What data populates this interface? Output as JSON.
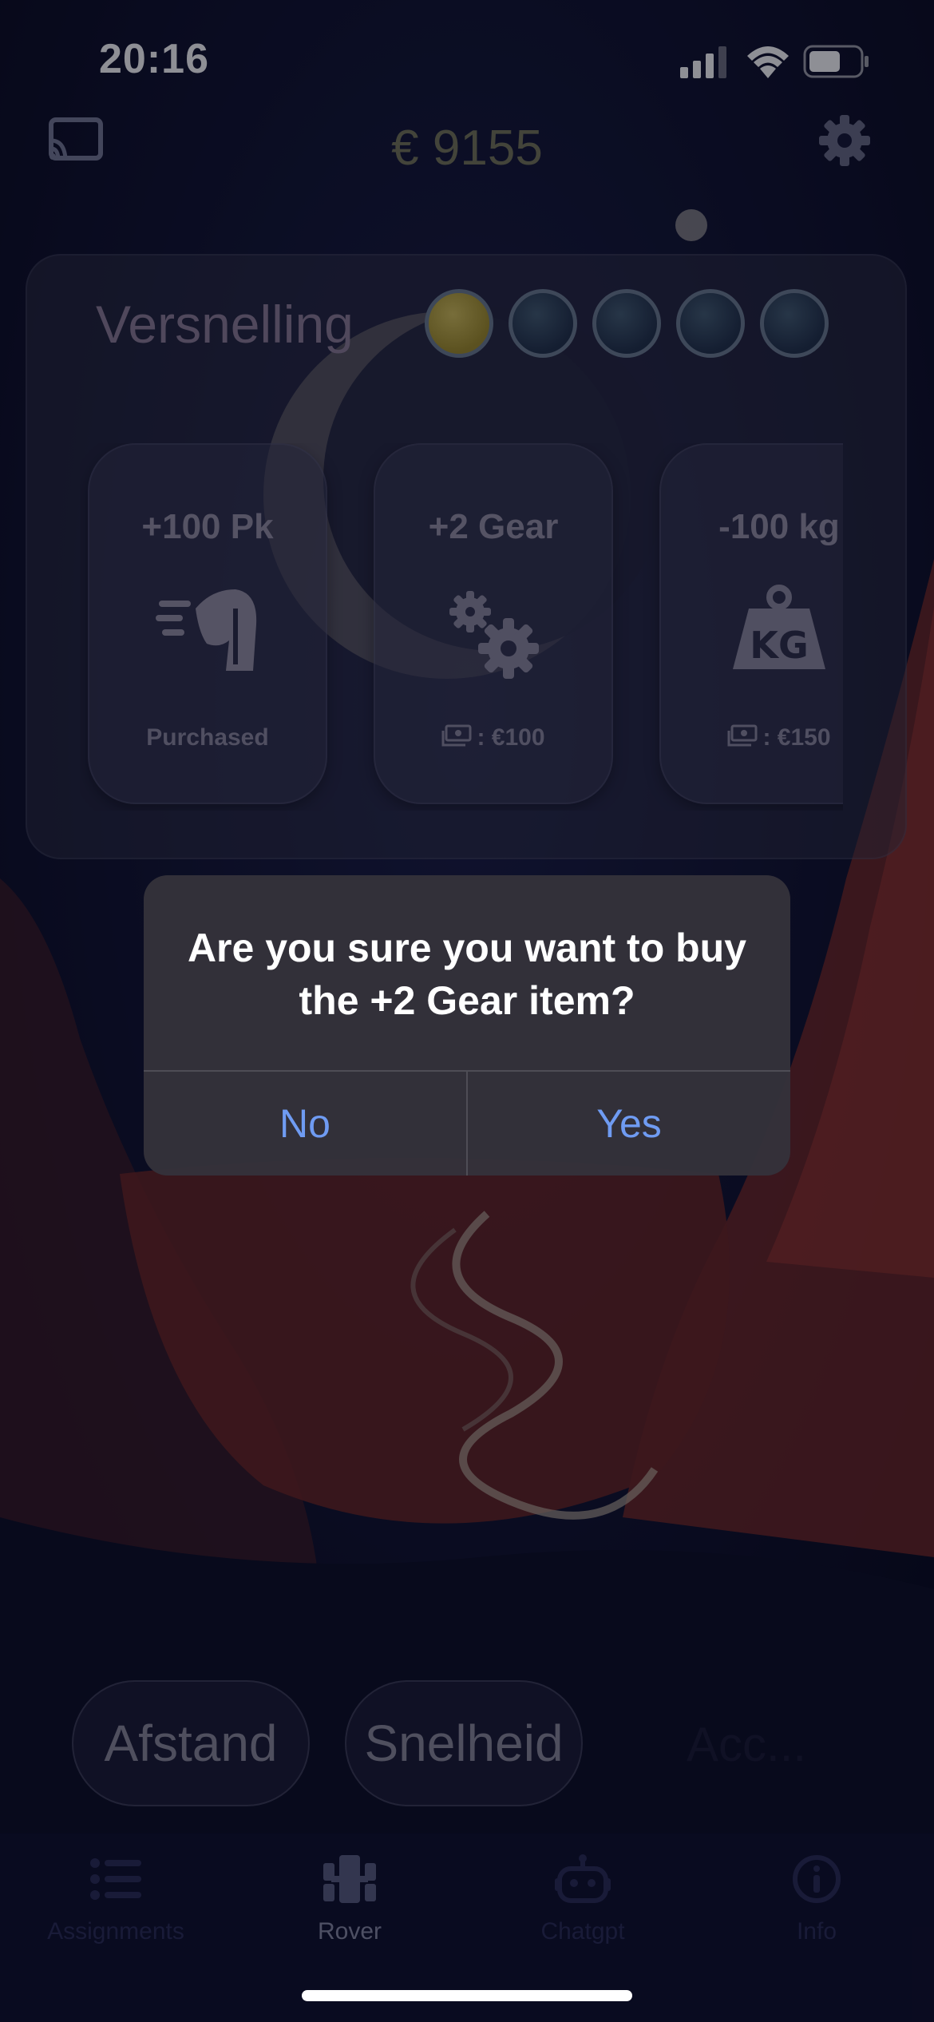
{
  "status_bar": {
    "time": "20:16"
  },
  "header": {
    "balance": "€ 9155",
    "cast_icon": "cast-icon",
    "settings_icon": "gear-icon"
  },
  "panel": {
    "title": "Versnelling",
    "level": 1,
    "level_max": 5,
    "cards": [
      {
        "title": "+100 Pk",
        "icon": "horse-speed-icon",
        "status": "Purchased"
      },
      {
        "title": "+2 Gear",
        "icon": "gears-icon",
        "price": ": €100"
      },
      {
        "title": "-100 kg",
        "icon": "kg-weight-icon",
        "price": ": €150"
      }
    ]
  },
  "dialog": {
    "message": "Are you sure you want to buy the +2 Gear item?",
    "no_label": "No",
    "yes_label": "Yes"
  },
  "bottom_buttons": {
    "distance": "Afstand",
    "speed": "Snelheid",
    "ghost": "Acc..."
  },
  "tabs": [
    {
      "label": "Assignments",
      "icon": "list-icon"
    },
    {
      "label": "Rover",
      "icon": "rover-icon",
      "active": true
    },
    {
      "label": "Chatgpt",
      "icon": "robot-icon"
    },
    {
      "label": "Info",
      "icon": "info-icon"
    }
  ],
  "colors": {
    "accent_link": "#6f9bf2",
    "level_on": "#d6c25a",
    "level_off": "#34495f",
    "background": "#0b0c22"
  }
}
